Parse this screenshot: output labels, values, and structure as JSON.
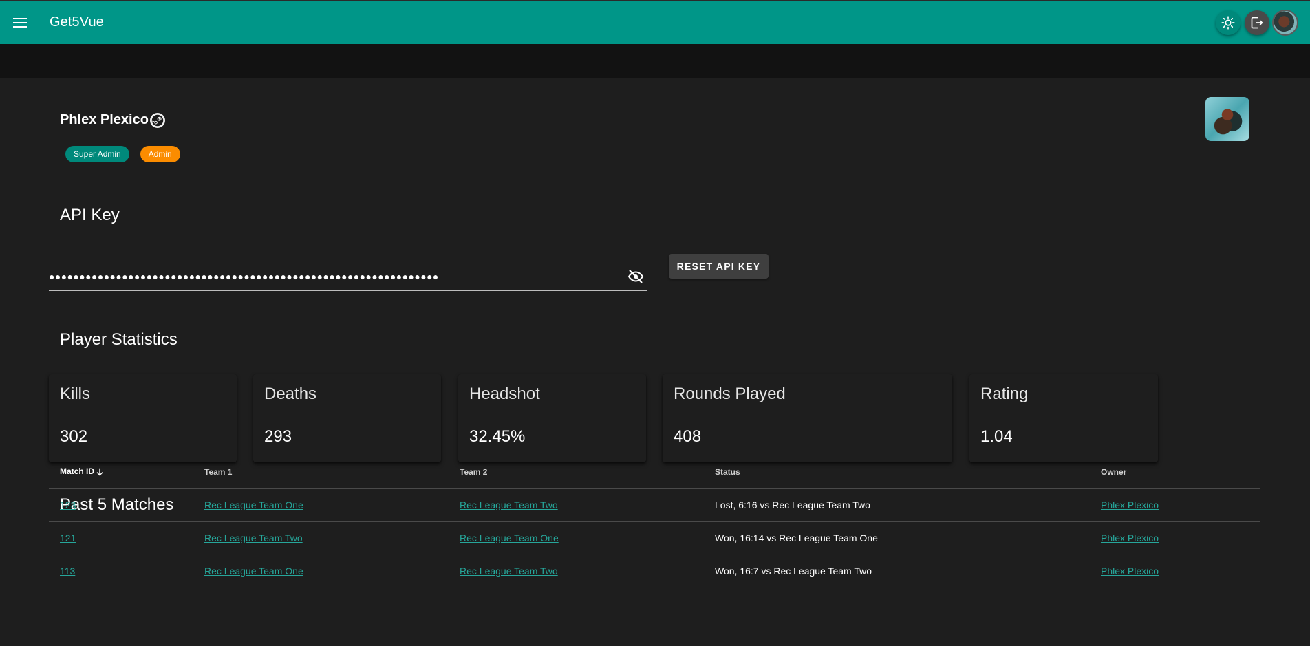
{
  "app": {
    "title": "Get5Vue"
  },
  "icons": {
    "menu": "menu-icon",
    "theme": "brightness-icon",
    "logout": "logout-icon",
    "steam": "steam-icon",
    "visibility": "eye-off-icon",
    "sort": "arrow-down-icon"
  },
  "colors": {
    "primary": "#009688",
    "admin": "#fb8c00",
    "link": "#26a69a",
    "background": "#1e1e1e"
  },
  "profile": {
    "name": "Phlex Plexico",
    "roles": [
      "Super Admin",
      "Admin"
    ]
  },
  "api_key": {
    "title": "API Key",
    "masked_value": "●●●●●●●●●●●●●●●●●●●●●●●●●●●●●●●●●●●●●●●●●●●●●●●●●●●●●●●●●●●●●●●●",
    "reset_label": "RESET API KEY"
  },
  "stats": {
    "title": "Player Statistics",
    "cards": [
      {
        "label": "Kills",
        "value": "302"
      },
      {
        "label": "Deaths",
        "value": "293"
      },
      {
        "label": "Headshot",
        "value": "32.45%"
      },
      {
        "label": "Rounds Played",
        "value": "408"
      },
      {
        "label": "Rating",
        "value": "1.04"
      }
    ]
  },
  "matches": {
    "title": "Past 5 Matches",
    "headers": [
      "Match ID",
      "Team 1",
      "Team 2",
      "Status",
      "Owner"
    ],
    "rows": [
      {
        "id": "123",
        "team1": "Rec League Team One",
        "team2": "Rec League Team Two",
        "status": "Lost, 6:16 vs Rec League Team Two",
        "owner": "Phlex Plexico"
      },
      {
        "id": "121",
        "team1": "Rec League Team Two",
        "team2": "Rec League Team One",
        "status": "Won, 16:14 vs Rec League Team One",
        "owner": "Phlex Plexico"
      },
      {
        "id": "113",
        "team1": "Rec League Team One",
        "team2": "Rec League Team Two",
        "status": "Won, 16:7 vs Rec League Team Two",
        "owner": "Phlex Plexico"
      }
    ]
  }
}
